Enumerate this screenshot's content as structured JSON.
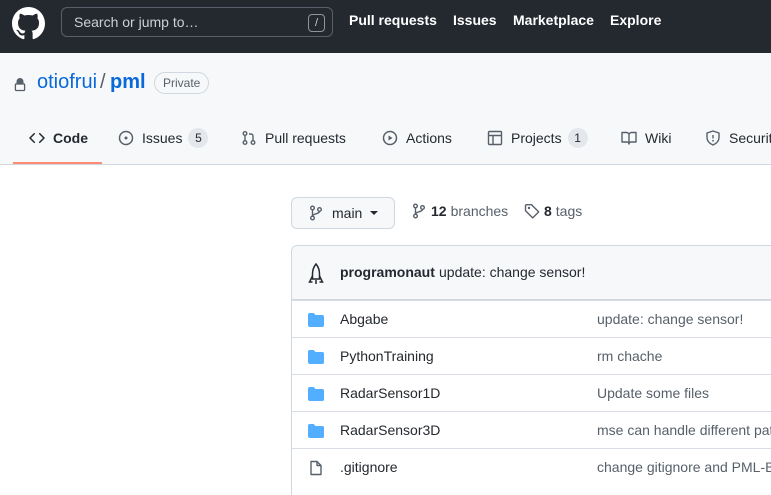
{
  "header": {
    "search_placeholder": "Search or jump to…",
    "search_shortcut": "/",
    "nav": [
      "Pull requests",
      "Issues",
      "Marketplace",
      "Explore"
    ]
  },
  "repo": {
    "owner": "otiofrui",
    "separator": "/",
    "name": "pml",
    "visibility": "Private"
  },
  "tabs": [
    {
      "label": "Code",
      "icon": "code-icon",
      "count": null,
      "selected": true
    },
    {
      "label": "Issues",
      "icon": "issue-opened-icon",
      "count": "5"
    },
    {
      "label": "Pull requests",
      "icon": "git-pull-request-icon",
      "count": null
    },
    {
      "label": "Actions",
      "icon": "play-icon",
      "count": null
    },
    {
      "label": "Projects",
      "icon": "table-icon",
      "count": "1"
    },
    {
      "label": "Wiki",
      "icon": "book-icon",
      "count": null
    },
    {
      "label": "Security",
      "icon": "shield-icon",
      "count": null
    }
  ],
  "branch": {
    "current": "main",
    "branches_count": "12",
    "branches_label": "branches",
    "tags_count": "8",
    "tags_label": "tags"
  },
  "latest_commit": {
    "author": "programonaut",
    "message": "update: change sensor!"
  },
  "files": [
    {
      "type": "folder",
      "name": "Abgabe",
      "message": "update: change sensor!"
    },
    {
      "type": "folder",
      "name": "PythonTraining",
      "message": "rm chache"
    },
    {
      "type": "folder",
      "name": "RadarSensor1D",
      "message": "Update some files"
    },
    {
      "type": "folder",
      "name": "RadarSensor3D",
      "message": "mse can handle different patterns"
    },
    {
      "type": "file",
      "name": ".gitignore",
      "message": "change gitignore and PML-Bericht"
    }
  ],
  "colors": {
    "header_bg": "#24292f",
    "link": "#0969da",
    "folder": "#54aeff",
    "tab_underline": "#fd8c73"
  }
}
